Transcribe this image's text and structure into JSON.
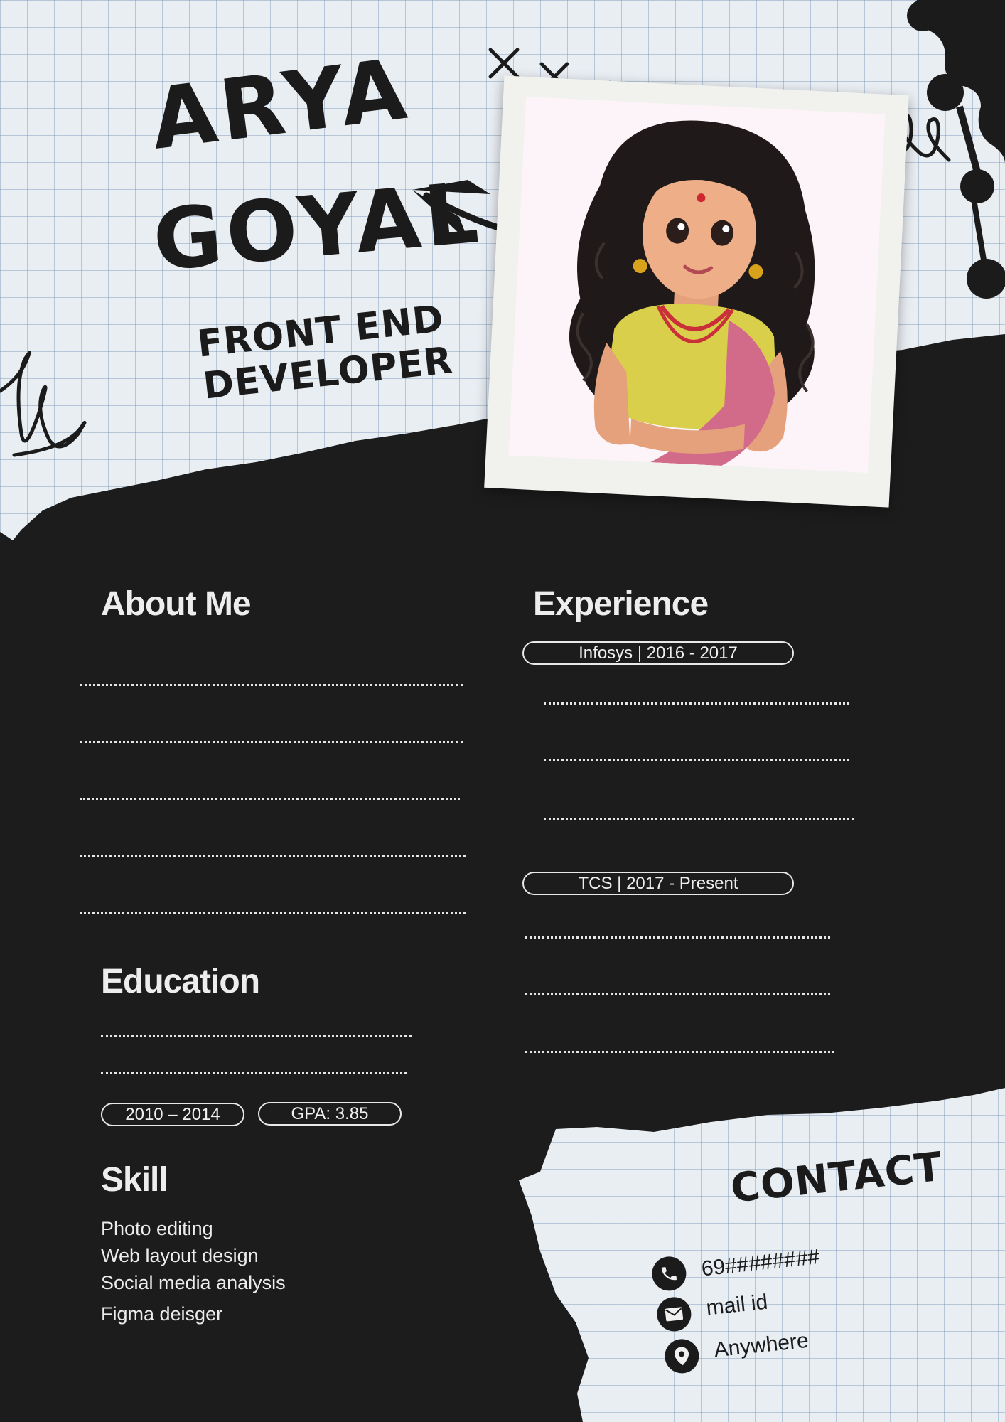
{
  "header": {
    "first_name": "ARYA",
    "last_name": "GOYAL",
    "role_line1": "FRONT END",
    "role_line2": "DEVELOPER"
  },
  "about": {
    "heading": "About Me"
  },
  "experience": {
    "heading": "Experience",
    "jobs": [
      {
        "label": "Infosys | 2016 - 2017"
      },
      {
        "label": "TCS | 2017 - Present"
      }
    ]
  },
  "education": {
    "heading": "Education",
    "years": "2010 – 2014",
    "gpa": "GPA: 3.85"
  },
  "skills": {
    "heading": "Skill",
    "items": [
      "Photo editing",
      "Web layout design",
      "Social media analysis",
      "Figma deisger"
    ]
  },
  "contact": {
    "heading": "CONTACT",
    "phone": "69########",
    "email": "mail id",
    "location": "Anywhere",
    "icons": {
      "phone": "phone-icon",
      "email": "mail-icon",
      "location": "location-pin-icon"
    }
  },
  "colors": {
    "background": "#1c1c1c",
    "paper": "#e9eef3",
    "ink": "#1b1b1b",
    "text_light": "#ededed"
  }
}
